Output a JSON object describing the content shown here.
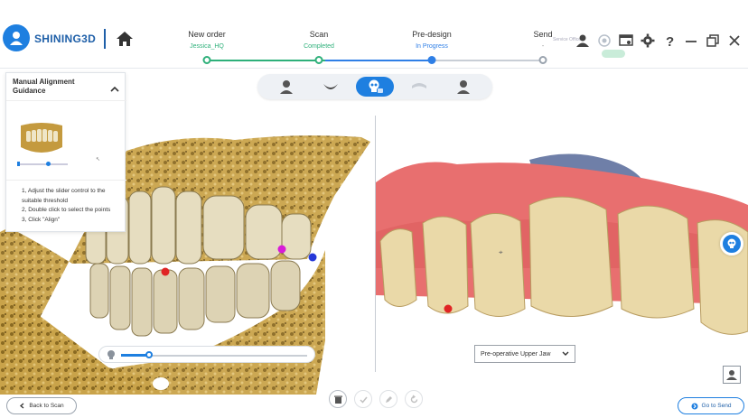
{
  "brand": {
    "name": "SHINING3D"
  },
  "steps": [
    {
      "label": "New order",
      "status": "Jessica_HQ",
      "status_color": "#2eb07a"
    },
    {
      "label": "Scan",
      "status": "Completed",
      "status_color": "#2eb07a"
    },
    {
      "label": "Pre-design",
      "status": "In Progress",
      "status_color": "#2f7fe6"
    },
    {
      "label": "Send",
      "status": "-",
      "status_color": "#888888"
    }
  ],
  "header": {
    "service_label": "Service Office"
  },
  "icons": {
    "home": "home-icon",
    "user": "user-icon",
    "target": "crosshair-icon",
    "window": "screen-icon",
    "settings": "gear-icon",
    "help": "help-icon",
    "minimize": "minimize-icon",
    "restore": "restore-icon",
    "close": "close-icon"
  },
  "guidance": {
    "title": "Manual Alignment Guidance",
    "steps": [
      "1, Adjust the slider control to the suitable threshold",
      "2, Double click to select the points",
      "3, Click \"Align\""
    ]
  },
  "threshold": {
    "value": 0.15
  },
  "jaw_select": {
    "selected": "Pre-operative Upper Jaw"
  },
  "buttons": {
    "back": "Back to Scan",
    "next": "Go to Send"
  },
  "colors": {
    "accent": "#1e7fe0",
    "done": "#2eb07a",
    "progress": "#2f7fe6"
  }
}
